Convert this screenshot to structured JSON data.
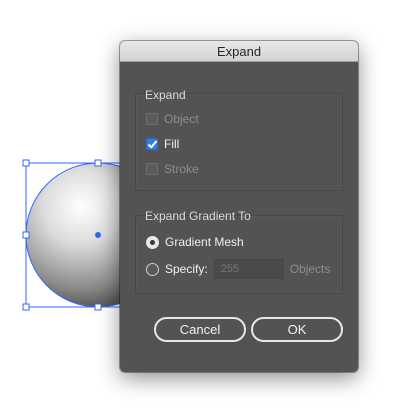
{
  "dialog": {
    "title": "Expand",
    "expand_group": {
      "title": "Expand",
      "options": [
        {
          "label": "Object",
          "checked": false,
          "enabled": false
        },
        {
          "label": "Fill",
          "checked": true,
          "enabled": true
        },
        {
          "label": "Stroke",
          "checked": false,
          "enabled": false
        }
      ]
    },
    "gradient_group": {
      "title": "Expand Gradient To",
      "gradient_mesh_label": "Gradient Mesh",
      "specify_label": "Specify:",
      "specify_value": "255",
      "objects_label": "Objects",
      "selected": "Gradient Mesh"
    },
    "buttons": {
      "cancel": "Cancel",
      "ok": "OK"
    }
  },
  "colors": {
    "dialog_bg": "#535353",
    "checkbox_accent": "#2f7ddc",
    "selection_blue": "#3366ff"
  }
}
